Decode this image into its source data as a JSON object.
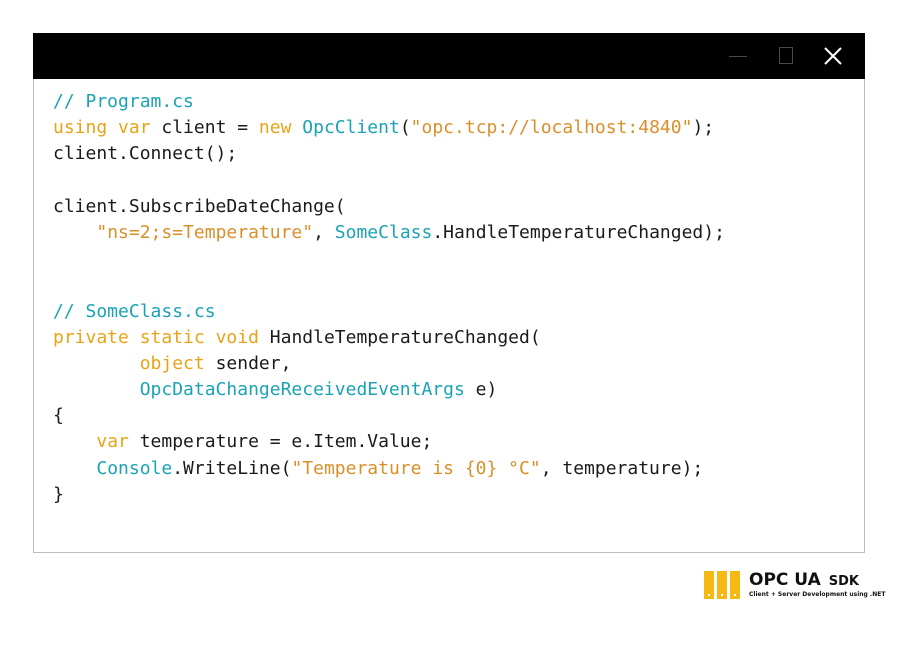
{
  "window": {
    "buttons": {
      "minimize": "minimize",
      "maximize": "maximize",
      "close": "close"
    }
  },
  "code": {
    "lines": [
      [
        {
          "t": "// Program.cs",
          "c": "comment"
        }
      ],
      [
        {
          "t": "using",
          "c": "kw"
        },
        {
          "t": " ",
          "c": "plain"
        },
        {
          "t": "var",
          "c": "kw"
        },
        {
          "t": " client = ",
          "c": "plain"
        },
        {
          "t": "new",
          "c": "kw"
        },
        {
          "t": " ",
          "c": "plain"
        },
        {
          "t": "OpcClient",
          "c": "type"
        },
        {
          "t": "(",
          "c": "plain"
        },
        {
          "t": "\"opc.tcp://localhost:4840\"",
          "c": "str"
        },
        {
          "t": ");",
          "c": "plain"
        }
      ],
      [
        {
          "t": "client.Connect();",
          "c": "plain"
        }
      ],
      [],
      [
        {
          "t": "client.SubscribeDateChange(",
          "c": "plain"
        }
      ],
      [
        {
          "t": "    ",
          "c": "plain"
        },
        {
          "t": "\"ns=2;s=Temperature\"",
          "c": "str"
        },
        {
          "t": ", ",
          "c": "plain"
        },
        {
          "t": "SomeClass",
          "c": "type"
        },
        {
          "t": ".HandleTemperatureChanged);",
          "c": "plain"
        }
      ],
      [],
      [],
      [
        {
          "t": "// SomeClass.cs",
          "c": "comment"
        }
      ],
      [
        {
          "t": "private",
          "c": "kw"
        },
        {
          "t": " ",
          "c": "plain"
        },
        {
          "t": "static",
          "c": "kw"
        },
        {
          "t": " ",
          "c": "plain"
        },
        {
          "t": "void",
          "c": "kw"
        },
        {
          "t": " HandleTemperatureChanged(",
          "c": "plain"
        }
      ],
      [
        {
          "t": "        ",
          "c": "plain"
        },
        {
          "t": "object",
          "c": "kw"
        },
        {
          "t": " sender,",
          "c": "plain"
        }
      ],
      [
        {
          "t": "        ",
          "c": "plain"
        },
        {
          "t": "OpcDataChangeReceivedEventArgs",
          "c": "type"
        },
        {
          "t": " e)",
          "c": "plain"
        }
      ],
      [
        {
          "t": "{",
          "c": "plain"
        }
      ],
      [
        {
          "t": "    ",
          "c": "plain"
        },
        {
          "t": "var",
          "c": "kw"
        },
        {
          "t": " temperature = e.Item.Value;",
          "c": "plain"
        }
      ],
      [
        {
          "t": "    ",
          "c": "plain"
        },
        {
          "t": "Console",
          "c": "type"
        },
        {
          "t": ".WriteLine(",
          "c": "plain"
        },
        {
          "t": "\"Temperature is {0} °C\"",
          "c": "str"
        },
        {
          "t": ", temperature);",
          "c": "plain"
        }
      ],
      [
        {
          "t": "}",
          "c": "plain"
        }
      ]
    ]
  },
  "logo": {
    "title": "OPC UA",
    "sdk": "SDK",
    "subtitle": "Client + Server Development using .NET",
    "bar_color": "#f5b914"
  },
  "colors": {
    "keyword": "#e8a317",
    "type": "#1ba3b5",
    "comment": "#1ba3b5",
    "string": "#d98f2a",
    "text": "#1a1a1a",
    "titlebar": "#000000"
  }
}
